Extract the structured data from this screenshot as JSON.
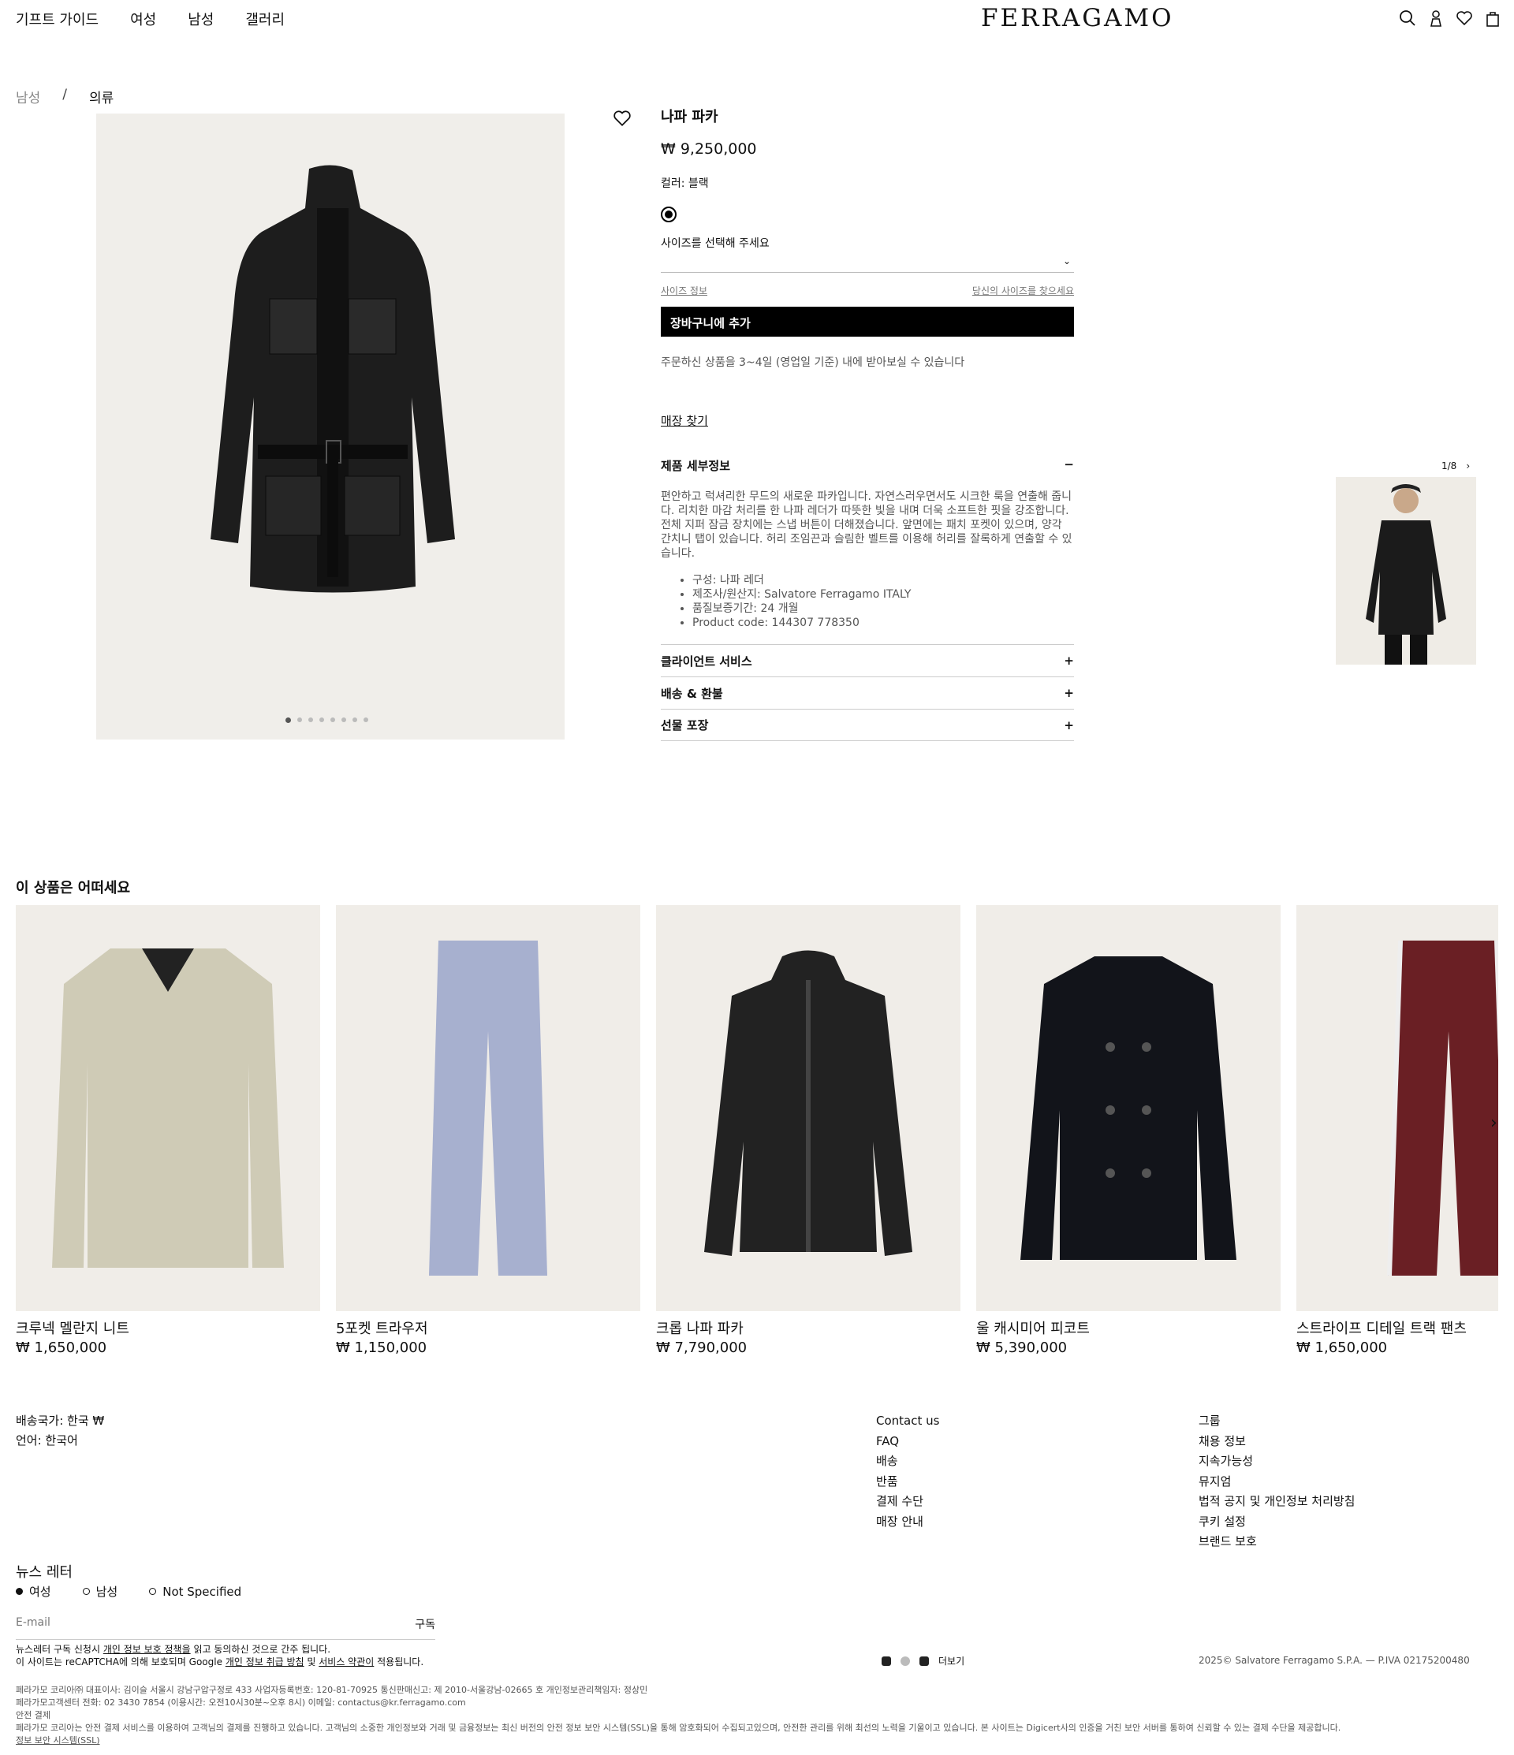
{
  "header": {
    "nav": [
      "기프트 가이드",
      "여성",
      "남성",
      "갤러리"
    ],
    "logo": "FERRAGAMO",
    "icons": [
      "search-icon",
      "account-icon",
      "wishlist-icon",
      "bag-icon"
    ]
  },
  "breadcrumb": {
    "parent": "남성",
    "separator": "/",
    "current": "의류"
  },
  "gallery": {
    "dots": 8,
    "active_dot": 1,
    "counter": "1/8"
  },
  "product": {
    "name": "나파 파카",
    "price": "₩ 9,250,000",
    "color_label": "컬러: 블랙",
    "size_placeholder": "사이즈를 선택해 주세요",
    "size_info": "사이즈 정보",
    "find_size": "당신의 사이즈를 찾으세요",
    "add_to_cart": "장바구니에 추가",
    "delivery": "주문하신 상품을 3~4일 (영업일 기준) 내에 받아보실 수 있습니다",
    "find_store": "매장 찾기",
    "details_title": "제품 세부정보",
    "description": "편안하고 럭셔리한 무드의 새로운 파카입니다. 자연스러우면서도 시크한 룩을 연출해 줍니다. 리치한 마감 처리를 한 나파 레더가 따뜻한 빛을 내며 더욱 소프트한 핏을 강조합니다. 전체 지퍼 잠금 장치에는 스냅 버튼이 더해졌습니다. 앞면에는 패치 포켓이 있으며, 양각 간치니 탭이 있습니다. 허리 조임끈과 슬림한 벨트를 이용해 허리를 잘록하게 연출할 수 있습니다.",
    "bullets": [
      "구성:  나파 레더",
      "제조사/원산지: Salvatore Ferragamo ITALY",
      "품질보증기간: 24 개월",
      "Product code: 144307 778350"
    ],
    "accordions": [
      "클라이언트 서비스",
      "배송 & 환불",
      "선물 포장"
    ]
  },
  "recommend": {
    "title": "이 상품은 어떠세요",
    "items": [
      {
        "name": "크루넥 멜란지 니트",
        "price": "₩ 1,650,000"
      },
      {
        "name": "5포켓 트라우저",
        "price": "₩ 1,150,000"
      },
      {
        "name": "크롭 나파 파카",
        "price": "₩ 7,790,000"
      },
      {
        "name": "울 캐시미어 피코트",
        "price": "₩ 5,390,000"
      },
      {
        "name": "스트라이프 디테일 트랙 팬츠",
        "price": "₩ 1,650,000"
      }
    ]
  },
  "footer": {
    "country": "배송국가: 한국 ₩",
    "language": "언어: 한국어",
    "col1": [
      "Contact us",
      "FAQ",
      "배송",
      "반품",
      "결제 수단",
      "매장 안내"
    ],
    "col2": [
      "그룹",
      "채용 정보",
      "지속가능성",
      "뮤지엄",
      "법적 공지 및 개인정보 처리방침",
      "쿠키 설정",
      "브랜드 보호"
    ],
    "newsletter": "뉴스 레터",
    "genders": [
      "여성",
      "남성",
      "Not Specified"
    ],
    "email_placeholder": "E-mail",
    "subscribe": "구독",
    "legal1_a": "뉴스레터 구독 신청시 ",
    "legal1_link": "개인 정보 보호 정책을",
    "legal1_b": " 읽고 동의하신 것으로 간주 됩니다.",
    "legal2_a": "이 사이트는 reCAPTCHA에 의해 보호되며 Google ",
    "legal2_link1": "개인 정보 취급 방침",
    "legal2_mid": " 및 ",
    "legal2_link2": "서비스 약관이",
    "legal2_b": " 적용됩니다.",
    "more": "더보기",
    "copyright": "2025© Salvatore Ferragamo S.P.A. — P.IVA 02175200480",
    "corp1": "페라가모 코리아㈜ 대표이사: 김이슬 서울시 강남구압구정로 433 사업자등록번호: 120-81-70925 통신판매신고: 제 2010-서울강남-02665 호 개인정보관리책임자: 정상민",
    "corp2": "페라가모고객센터 전화: 02 3430 7854 (이용시간: 오전10시30분~오후 8시) 이메일: contactus@kr.ferragamo.com",
    "corp3": "안전 결제",
    "corp4": "페라가모 코리아는 안전 결제 서비스를 이용하여 고객님의 결제를 진행하고 있습니다. 고객님의 소중한 개인정보와 거래 및 금융정보는 최신 버전의 안전 정보 보안 시스템(SSL)을 통해 암호화되어 수집되고있으며, 안전한 관리를 위해 최선의 노력을 기울이고 있습니다. 본 사이트는 Digicert사의 인증을 거친 보안 서버를 통하여 신뢰할 수 있는 결제 수단을 제공합니다.",
    "corp5": "정보 보안 시스템(SSL)"
  }
}
